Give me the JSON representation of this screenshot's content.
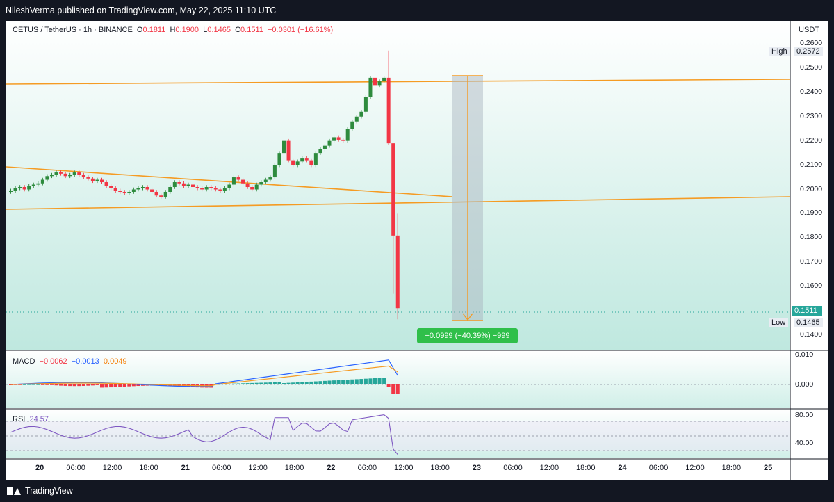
{
  "header": {
    "published_text": "NileshVerma published on TradingView.com, May 22, 2025 11:10 UTC"
  },
  "footer": {
    "brand": "TradingView"
  },
  "symbol": {
    "pair": "CETUS / TetherUS · 1h · BINANCE",
    "open_label": "O",
    "open_value": "0.1811",
    "high_label": "H",
    "high_value": "0.1900",
    "low_label": "L",
    "low_value": "0.1465",
    "close_label": "C",
    "close_value": "0.1511",
    "change": "−0.0301 (−16.61%)"
  },
  "price_axis": {
    "currency": "USDT",
    "ticks": [
      "0.2600",
      "0.2500",
      "0.2400",
      "0.2300",
      "0.2200",
      "0.2100",
      "0.2000",
      "0.1900",
      "0.1800",
      "0.1700",
      "0.1600",
      "0.1400"
    ],
    "high_label": "High",
    "high_value": "0.2572",
    "low_label": "Low",
    "low_value": "0.1465",
    "last_price": "0.1511"
  },
  "macd": {
    "label": "MACD",
    "v1": "−0.0062",
    "v2": "−0.0013",
    "v3": "0.0049",
    "ticks": [
      "0.010",
      "0.000"
    ]
  },
  "rsi": {
    "label": "RSI",
    "value": "24.57",
    "ticks": [
      "80.00",
      "40.00"
    ]
  },
  "measure": {
    "text": "−0.0999 (−40.39%) −999"
  },
  "time_axis": [
    {
      "label": "20",
      "day": true
    },
    {
      "label": "06:00",
      "day": false
    },
    {
      "label": "12:00",
      "day": false
    },
    {
      "label": "18:00",
      "day": false
    },
    {
      "label": "21",
      "day": true
    },
    {
      "label": "06:00",
      "day": false
    },
    {
      "label": "12:00",
      "day": false
    },
    {
      "label": "18:00",
      "day": false
    },
    {
      "label": "22",
      "day": true
    },
    {
      "label": "06:00",
      "day": false
    },
    {
      "label": "12:00",
      "day": false
    },
    {
      "label": "18:00",
      "day": false
    },
    {
      "label": "23",
      "day": true
    },
    {
      "label": "06:00",
      "day": false
    },
    {
      "label": "12:00",
      "day": false
    },
    {
      "label": "18:00",
      "day": false
    },
    {
      "label": "24",
      "day": true
    },
    {
      "label": "06:00",
      "day": false
    },
    {
      "label": "12:00",
      "day": false
    },
    {
      "label": "18:00",
      "day": false
    },
    {
      "label": "25",
      "day": true
    }
  ],
  "colors": {
    "up": "#26a69a",
    "up_green": "#2e8b3e",
    "down": "#f23645",
    "trendline": "#f59b23",
    "macd_line": "#2962ff",
    "signal_line": "#f59b23",
    "rsi_line": "#7e57c2",
    "measure": "#2fbf4a"
  },
  "chart_data": {
    "type": "candlestick",
    "title": "CETUS / TetherUS · 1h · BINANCE",
    "ylabel": "USDT",
    "ylim": [
      0.138,
      0.262
    ],
    "candles_close": [
      0.1995,
      0.2005,
      0.201,
      0.2,
      0.2015,
      0.202,
      0.2025,
      0.204,
      0.2055,
      0.206,
      0.207,
      0.2065,
      0.2055,
      0.206,
      0.207,
      0.206,
      0.205,
      0.2045,
      0.2035,
      0.204,
      0.203,
      0.2015,
      0.2005,
      0.1995,
      0.199,
      0.1985,
      0.199,
      0.2,
      0.2005,
      0.201,
      0.2,
      0.199,
      0.1975,
      0.197,
      0.199,
      0.201,
      0.203,
      0.2025,
      0.2015,
      0.202,
      0.201,
      0.2005,
      0.2,
      0.201,
      0.2005,
      0.2,
      0.1995,
      0.2005,
      0.202,
      0.205,
      0.204,
      0.2025,
      0.201,
      0.2,
      0.202,
      0.203,
      0.204,
      0.205,
      0.21,
      0.215,
      0.22,
      0.212,
      0.21,
      0.2115,
      0.213,
      0.212,
      0.21,
      0.215,
      0.2165,
      0.218,
      0.22,
      0.2215,
      0.2205,
      0.22,
      0.225,
      0.228,
      0.23,
      0.232,
      0.238,
      0.246,
      0.243,
      0.2445,
      0.246,
      0.219,
      0.181,
      0.1511
    ],
    "macd_values": {
      "macd": "−0.0062",
      "signal": "−0.0013",
      "histogram": "0.0049"
    },
    "rsi_value": 24.57
  }
}
